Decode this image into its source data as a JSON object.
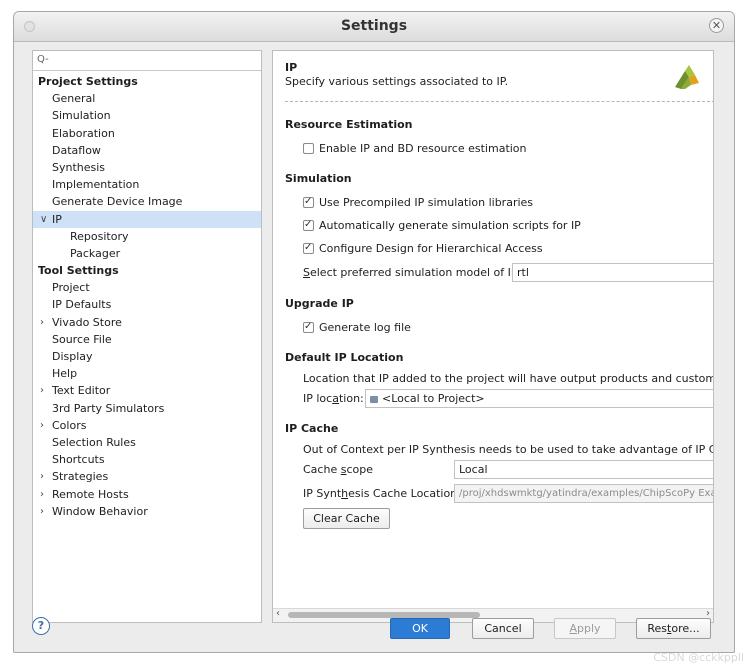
{
  "window": {
    "title": "Settings"
  },
  "search": {
    "placeholder": ""
  },
  "tree": {
    "project_heading": "Project Settings",
    "project_items": [
      "General",
      "Simulation",
      "Elaboration",
      "Dataflow",
      "Synthesis",
      "Implementation",
      "Generate Device Image"
    ],
    "ip_item": "IP",
    "ip_children": [
      "Repository",
      "Packager"
    ],
    "tool_heading": "Tool Settings",
    "tool_items": [
      {
        "label": "Project",
        "expandable": false
      },
      {
        "label": "IP Defaults",
        "expandable": false
      },
      {
        "label": "Vivado Store",
        "expandable": true
      },
      {
        "label": "Source File",
        "expandable": false
      },
      {
        "label": "Display",
        "expandable": false
      },
      {
        "label": "Help",
        "expandable": false
      },
      {
        "label": "Text Editor",
        "expandable": true
      },
      {
        "label": "3rd Party Simulators",
        "expandable": false
      },
      {
        "label": "Colors",
        "expandable": true
      },
      {
        "label": "Selection Rules",
        "expandable": false
      },
      {
        "label": "Shortcuts",
        "expandable": false
      },
      {
        "label": "Strategies",
        "expandable": true
      },
      {
        "label": "Remote Hosts",
        "expandable": true
      },
      {
        "label": "Window Behavior",
        "expandable": true
      }
    ]
  },
  "panel": {
    "title": "IP",
    "subtitle": "Specify various settings associated to IP.",
    "logo_icon": "xilinx-logo-icon"
  },
  "resource_estimation": {
    "heading": "Resource Estimation",
    "enable_label": "Enable IP and BD resource estimation",
    "enable_checked": false
  },
  "simulation": {
    "heading": "Simulation",
    "precompiled_label": "Use Precompiled IP simulation libraries",
    "precompiled_checked": true,
    "autogen_label": "Automatically generate simulation scripts for IP",
    "autogen_checked": true,
    "hierarchical_label": "Configure Design for Hierarchical Access",
    "hierarchical_checked": true,
    "model_label_first": "S",
    "model_label_rest": "elect preferred simulation model of IP:",
    "model_value": "rtl"
  },
  "upgrade": {
    "heading": "Upgrade IP",
    "log_label": "Generate log file",
    "log_checked": true
  },
  "default_location": {
    "heading": "Default IP Location",
    "description": "Location that IP added to the project will have output products and customizati",
    "location_label_a": "IP loc",
    "location_label_b": "a",
    "location_label_c": "tion:",
    "location_value": "<Local to Project>"
  },
  "ip_cache": {
    "heading": "IP Cache",
    "description": "Out of Context per IP Synthesis needs to be used to take advantage of IP Cachi",
    "scope_label_a": "Cache ",
    "scope_label_b": "s",
    "scope_label_c": "cope",
    "scope_value": "Local",
    "location_label_a": "IP Synt",
    "location_label_b": "h",
    "location_label_c": "esis Cache Location",
    "location_value": "/proj/xhdswmktg/yatindra/examples/ChipScoPy Exa",
    "clear_label": "Clear Cache"
  },
  "footer": {
    "help_label": "?",
    "ok_label": "OK",
    "cancel_label": "Cancel",
    "apply_label_a": "A",
    "apply_label_b": "pply",
    "restore_label_a": "Res",
    "restore_label_b": "t",
    "restore_label_c": "ore..."
  },
  "watermark": "CSDN @cckkppll",
  "colors": {
    "accent": "#2c7bd5",
    "selection": "#cfe1f7"
  }
}
